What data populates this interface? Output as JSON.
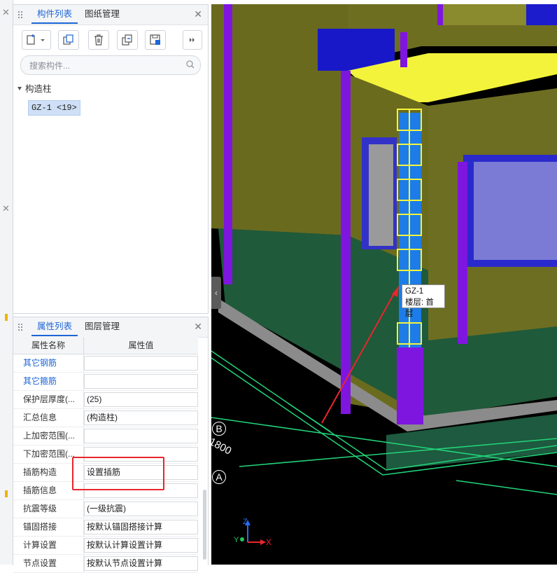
{
  "component_panel": {
    "tabs": [
      {
        "label": "构件列表",
        "active": true
      },
      {
        "label": "图纸管理",
        "active": false
      }
    ],
    "toolbar": [
      "new-icon",
      "copy-icon",
      "delete-icon",
      "copy-to-floor-icon",
      "save-icon",
      "more-icon"
    ],
    "search_placeholder": "搜索构件...",
    "tree": {
      "root_label": "构造柱",
      "items": [
        {
          "label": "GZ-1 <19>",
          "selected": true
        }
      ]
    }
  },
  "property_panel": {
    "tabs": [
      {
        "label": "属性列表",
        "active": true
      },
      {
        "label": "图层管理",
        "active": false
      }
    ],
    "header": {
      "name": "属性名称",
      "value": "属性值"
    },
    "rows": [
      {
        "name": "其它钢筋",
        "value": "",
        "link": true
      },
      {
        "name": "其它箍筋",
        "value": "",
        "link": true
      },
      {
        "name": "保护层厚度(...",
        "value": "(25)",
        "link": false
      },
      {
        "name": "汇总信息",
        "value": "(构造柱)",
        "link": false
      },
      {
        "name": "上加密范围(...",
        "value": "",
        "link": false
      },
      {
        "name": "下加密范围(...",
        "value": "",
        "link": false
      },
      {
        "name": "插筋构造",
        "value": "设置插筋",
        "link": false
      },
      {
        "name": "插筋信息",
        "value": "",
        "link": false
      },
      {
        "name": "抗震等级",
        "value": "(一级抗震)",
        "link": false
      },
      {
        "name": "锚固搭接",
        "value": "按默认锚固搭接计算",
        "link": false
      },
      {
        "name": "计算设置",
        "value": "按默认计算设置计算",
        "link": false
      },
      {
        "name": "节点设置",
        "value": "按默认节点设置计算",
        "link": false
      }
    ]
  },
  "viewport": {
    "tooltip": {
      "name": "GZ-1",
      "floor": "楼层: 首层"
    },
    "axis_labels": [
      "B",
      "A"
    ],
    "dimension_label": "1800",
    "axes": {
      "z": "Z",
      "y": "Y",
      "x": "X"
    },
    "colors": {
      "wall": "#6b6b1e",
      "slab_top": "#f3f33b",
      "column": "#7f16e0",
      "selected_column": "#1d7ce8",
      "base": "#1f5a3a",
      "grid": "#22d67a",
      "annotation_arrow": "#e8262c"
    }
  }
}
